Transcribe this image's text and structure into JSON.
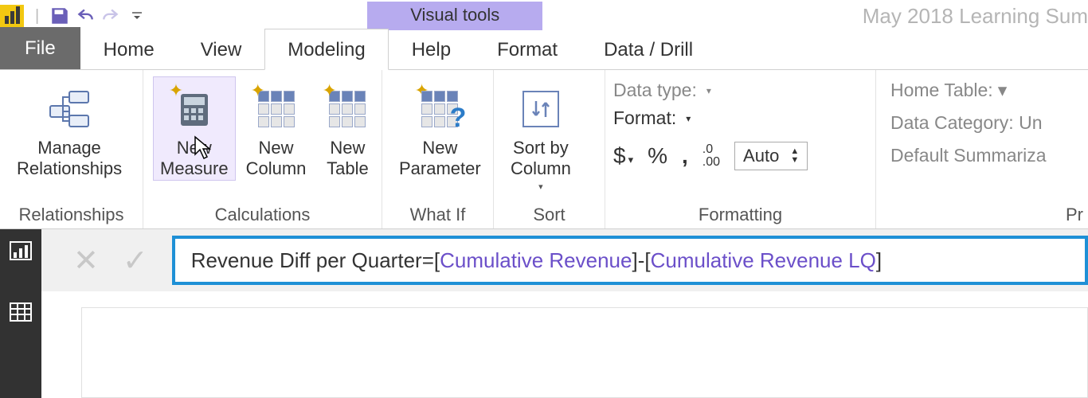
{
  "titlebar": {
    "doc_title": "May 2018 Learning Sum",
    "contextual_tab": "Visual tools"
  },
  "tabs": {
    "file": "File",
    "home": "Home",
    "view": "View",
    "modeling": "Modeling",
    "help": "Help",
    "format": "Format",
    "data_drill": "Data / Drill"
  },
  "ribbon": {
    "relationships": {
      "manage": "Manage\nRelationships",
      "group": "Relationships"
    },
    "calculations": {
      "new_measure": "New\nMeasure",
      "new_column": "New\nColumn",
      "new_table": "New\nTable",
      "group": "Calculations"
    },
    "whatif": {
      "new_parameter": "New\nParameter",
      "group": "What If"
    },
    "sort": {
      "sort_by_column": "Sort by\nColumn",
      "group": "Sort"
    },
    "formatting": {
      "data_type": "Data type:",
      "format": "Format:",
      "currency": "$",
      "percent": "%",
      "comma": ",",
      "decimal_icon": ".00",
      "auto": "Auto",
      "group": "Formatting"
    },
    "properties": {
      "home_table": "Home Table:",
      "data_category": "Data Category: Un",
      "default_summarization": "Default Summariza",
      "group": "Pr"
    }
  },
  "formula": {
    "name": "Revenue Diff per Quarter",
    "eq": " = ",
    "b1": "[",
    "m1": "Cumulative Revenue",
    "b2": "]",
    "op": " - ",
    "b3": "[",
    "m2": "Cumulative Revenue LQ",
    "b4": "]"
  }
}
